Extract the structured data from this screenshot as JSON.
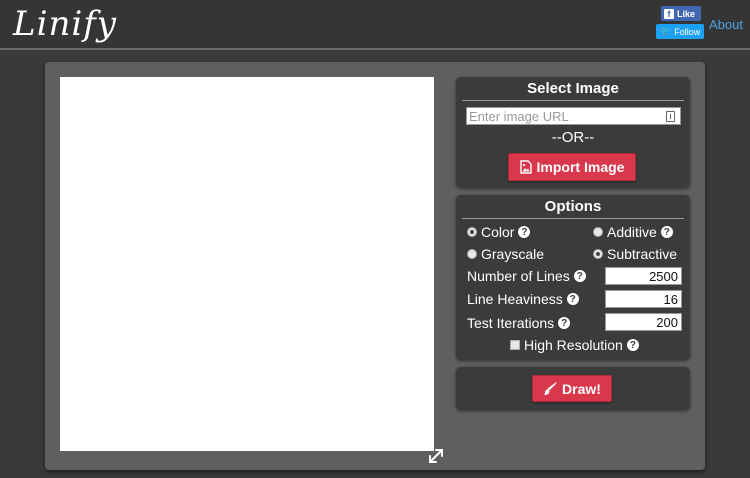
{
  "header": {
    "logo": "Linify",
    "fb_like": "Like",
    "tw_follow": "Follow",
    "about": "About"
  },
  "select_image": {
    "title": "Select Image",
    "url_placeholder": "Enter image URL",
    "or_text": "--OR--",
    "import_label": "Import Image"
  },
  "options": {
    "title": "Options",
    "color_label": "Color",
    "additive_label": "Additive",
    "grayscale_label": "Grayscale",
    "subtractive_label": "Subtractive",
    "num_lines_label": "Number of Lines",
    "num_lines_value": "2500",
    "heaviness_label": "Line Heaviness",
    "heaviness_value": "16",
    "iterations_label": "Test Iterations",
    "iterations_value": "200",
    "high_res_label": "High Resolution",
    "help_glyph": "?",
    "color_selected": true,
    "subtractive_selected": true,
    "high_res_checked": false
  },
  "draw": {
    "label": "Draw!"
  },
  "colors": {
    "accent_red": "#d9384c",
    "link_blue": "#4aa3df",
    "facebook_blue": "#4267b2",
    "twitter_blue": "#1da1f2"
  },
  "icons": {
    "facebook": "facebook-icon",
    "twitter": "twitter-icon",
    "input_info": "input-info-icon",
    "import": "image-file-icon",
    "help": "help-icon",
    "draw": "paintbrush-icon",
    "resize": "resize-expand-icon"
  }
}
